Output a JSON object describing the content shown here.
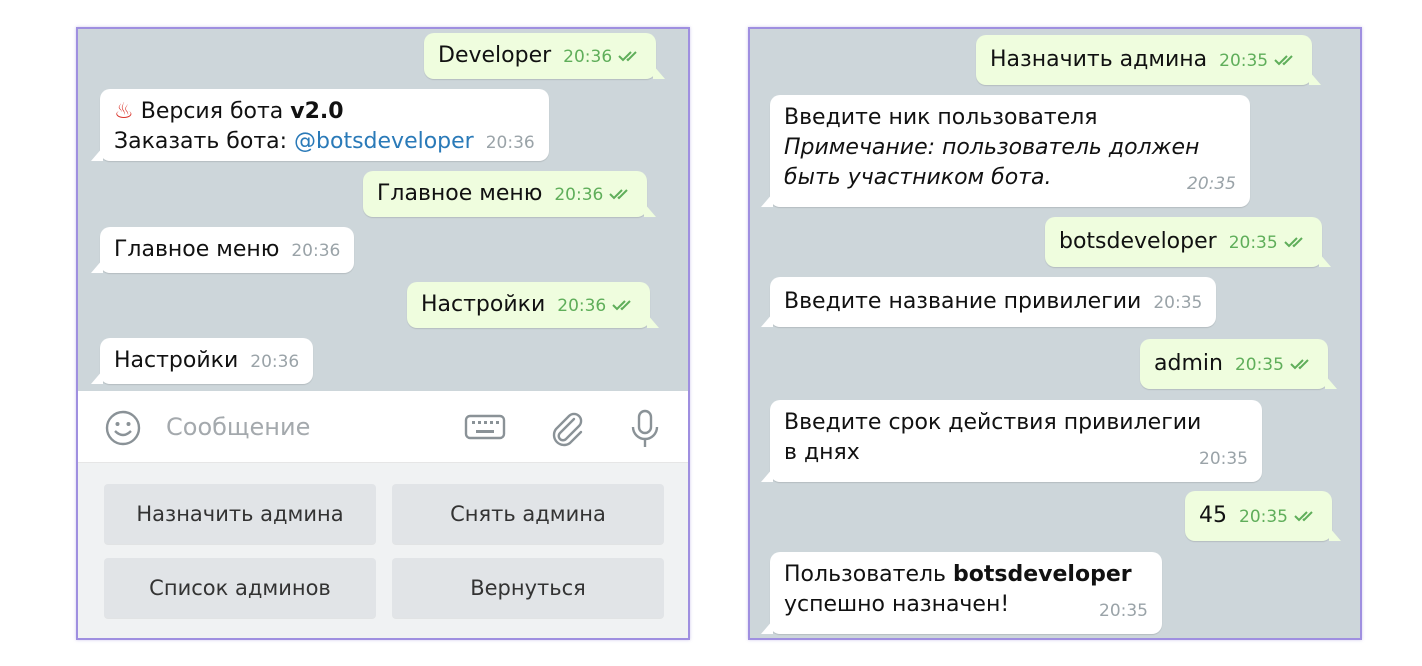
{
  "left": {
    "messages": [
      {
        "id": "l1",
        "dir": "out",
        "text": "Developer",
        "time": "20:36"
      },
      {
        "id": "l2",
        "dir": "in",
        "emoji": "♨",
        "line1_prefix": "Версия бота ",
        "version": "v2.0",
        "line2_prefix": "Заказать бота: ",
        "link": "@botsdeveloper",
        "time": "20:36"
      },
      {
        "id": "l3",
        "dir": "out",
        "text": "Главное меню",
        "time": "20:36"
      },
      {
        "id": "l4",
        "dir": "in",
        "text": "Главное меню",
        "time": "20:36"
      },
      {
        "id": "l5",
        "dir": "out",
        "text": "Настройки",
        "time": "20:36"
      },
      {
        "id": "l6",
        "dir": "in",
        "text": "Настройки",
        "time": "20:36"
      }
    ],
    "input": {
      "placeholder": "Сообщение"
    },
    "keyboard": [
      "Назначить админа",
      "Снять админа",
      "Список админов",
      "Вернуться"
    ]
  },
  "right": {
    "messages": [
      {
        "id": "r1",
        "dir": "out",
        "text": "Назначить админа",
        "time": "20:35"
      },
      {
        "id": "r2",
        "dir": "in",
        "line1": "Введите ник пользователя",
        "line2": "Примечание: пользователь должен",
        "line3": "быть участником бота.",
        "time": "20:35"
      },
      {
        "id": "r3",
        "dir": "out",
        "text": "botsdeveloper",
        "time": "20:35"
      },
      {
        "id": "r4",
        "dir": "in",
        "text": "Введите название привилегии",
        "time": "20:35"
      },
      {
        "id": "r5",
        "dir": "out",
        "text": "admin",
        "time": "20:35"
      },
      {
        "id": "r6",
        "dir": "in",
        "line1": "Введите срок действия привилегии",
        "line2": "в днях",
        "time": "20:35"
      },
      {
        "id": "r7",
        "dir": "out",
        "text": "45",
        "time": "20:35"
      },
      {
        "id": "r8",
        "dir": "in",
        "line1_prefix": "Пользователь ",
        "username": "botsdeveloper",
        "line2": "успешно назначен!",
        "time": "20:35"
      }
    ]
  },
  "colors": {
    "frame": "#9f8fe0",
    "chat_bg": "#cdd6da",
    "outgoing_bubble": "#effdde",
    "incoming_bubble": "#ffffff",
    "check_mark": "#5fae5a",
    "link": "#2a7ab8"
  },
  "icons": [
    "emoji-icon",
    "keyboard-icon",
    "paperclip-icon",
    "microphone-icon",
    "double-check-icon"
  ]
}
